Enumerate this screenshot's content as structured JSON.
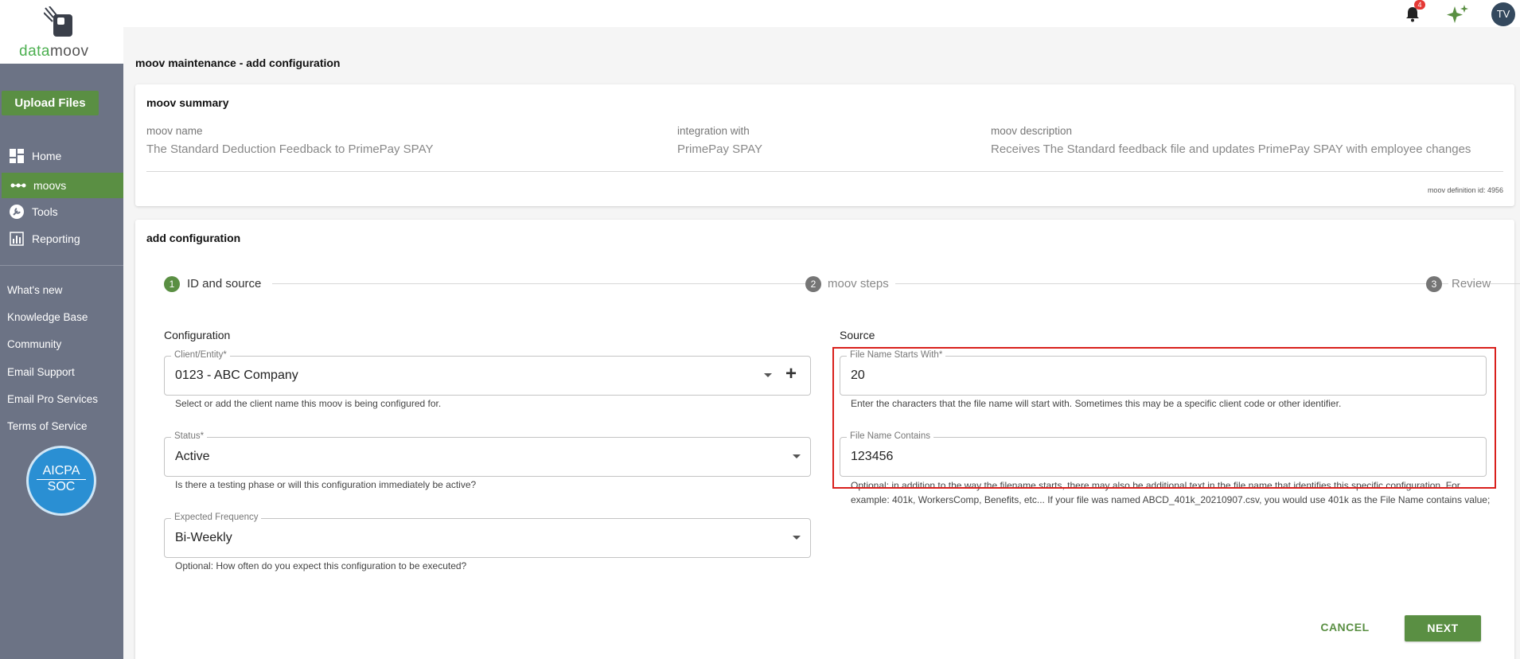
{
  "brand": {
    "logo_part1": "data",
    "logo_part2": "moov"
  },
  "sidebar": {
    "upload_label": "Upload Files",
    "nav": [
      {
        "label": "Home",
        "icon": "dashboard-icon"
      },
      {
        "label": "moovs",
        "icon": "moovs-icon"
      },
      {
        "label": "Tools",
        "icon": "wrench-icon"
      },
      {
        "label": "Reporting",
        "icon": "bar-chart-icon"
      }
    ],
    "links": [
      "What's new",
      "Knowledge Base",
      "Community",
      "Email Support",
      "Email Pro Services",
      "Terms of Service"
    ],
    "badge": {
      "line1": "AICPA",
      "line2": "SOC"
    }
  },
  "topbar": {
    "notification_count": "4",
    "avatar_initials": "TV"
  },
  "page": {
    "title": "moov maintenance - add configuration"
  },
  "summary": {
    "title": "moov summary",
    "name_label": "moov name",
    "name_value": "The Standard Deduction Feedback to PrimePay SPAY",
    "integration_label": "integration with",
    "integration_value": "PrimePay SPAY",
    "description_label": "moov description",
    "description_value": "Receives The Standard feedback file and updates PrimePay SPAY with employee changes",
    "definition_id": "moov definition id: 4956"
  },
  "config": {
    "title": "add configuration",
    "steps": [
      {
        "num": "1",
        "label": "ID and source"
      },
      {
        "num": "2",
        "label": "moov steps"
      },
      {
        "num": "3",
        "label": "Review"
      }
    ],
    "configuration_heading": "Configuration",
    "source_heading": "Source",
    "client": {
      "label": "Client/Entity*",
      "value": "0123 - ABC Company",
      "helper": "Select or add the client name this moov is being configured for."
    },
    "status": {
      "label": "Status*",
      "value": "Active",
      "helper": "Is there a testing phase or will this configuration immediately be active?"
    },
    "frequency": {
      "label": "Expected Frequency",
      "value": "Bi-Weekly",
      "helper": "Optional: How often do you expect this configuration to be executed?"
    },
    "starts_with": {
      "label": "File Name Starts With*",
      "value": "20",
      "helper": "Enter the characters that the file name will start with. Sometimes this may be a specific client code or other identifier."
    },
    "contains": {
      "label": "File Name Contains",
      "value": "123456",
      "helper": "Optional: in addition to the way the filename starts, there may also be additional text in the file name that identifies this specific configuration. For example: 401k, WorkersComp, Benefits, etc... If your file was named ABCD_401k_20210907.csv, you would use 401k as the File Name contains value;"
    },
    "cancel_label": "CANCEL",
    "next_label": "NEXT"
  },
  "colors": {
    "accent": "#5a8f43",
    "sidebar": "#6c7385",
    "highlight": "#d9201c",
    "step_active": "#5a8f43",
    "step_inactive": "#757575"
  }
}
